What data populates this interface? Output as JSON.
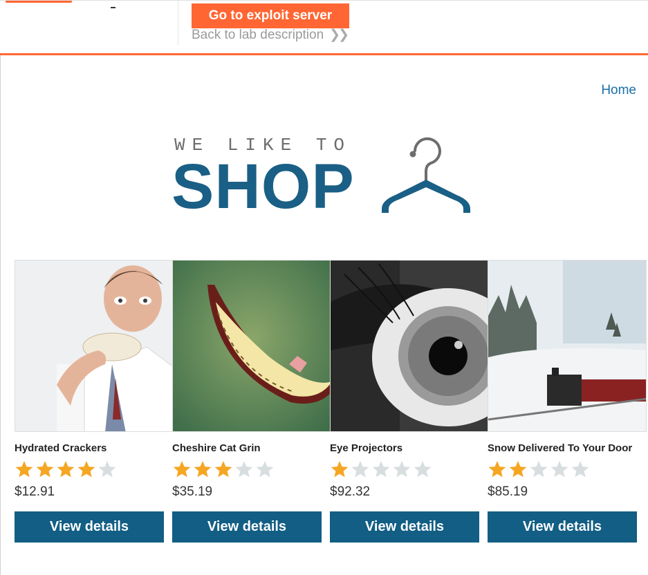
{
  "header": {
    "exploit_button": "Go to exploit server",
    "back_link": "Back to lab description",
    "accent_color": "#ff6633"
  },
  "nav": {
    "home": "Home"
  },
  "banner": {
    "line1": "WE LIKE TO",
    "line2": "SHOP",
    "icon": "hanger-icon"
  },
  "products": [
    {
      "title": "Hydrated Crackers",
      "rating": 4,
      "price": "$12.91",
      "button": "View details"
    },
    {
      "title": "Cheshire Cat Grin",
      "rating": 3,
      "price": "$35.19",
      "button": "View details"
    },
    {
      "title": "Eye Projectors",
      "rating": 1,
      "price": "$92.32",
      "button": "View details"
    },
    {
      "title": "Snow Delivered To Your Door",
      "rating": 2,
      "price": "$85.19",
      "button": "View details"
    }
  ],
  "colors": {
    "brand_blue": "#125e84",
    "star_filled": "#f5a623",
    "star_empty": "#d8dde0"
  }
}
